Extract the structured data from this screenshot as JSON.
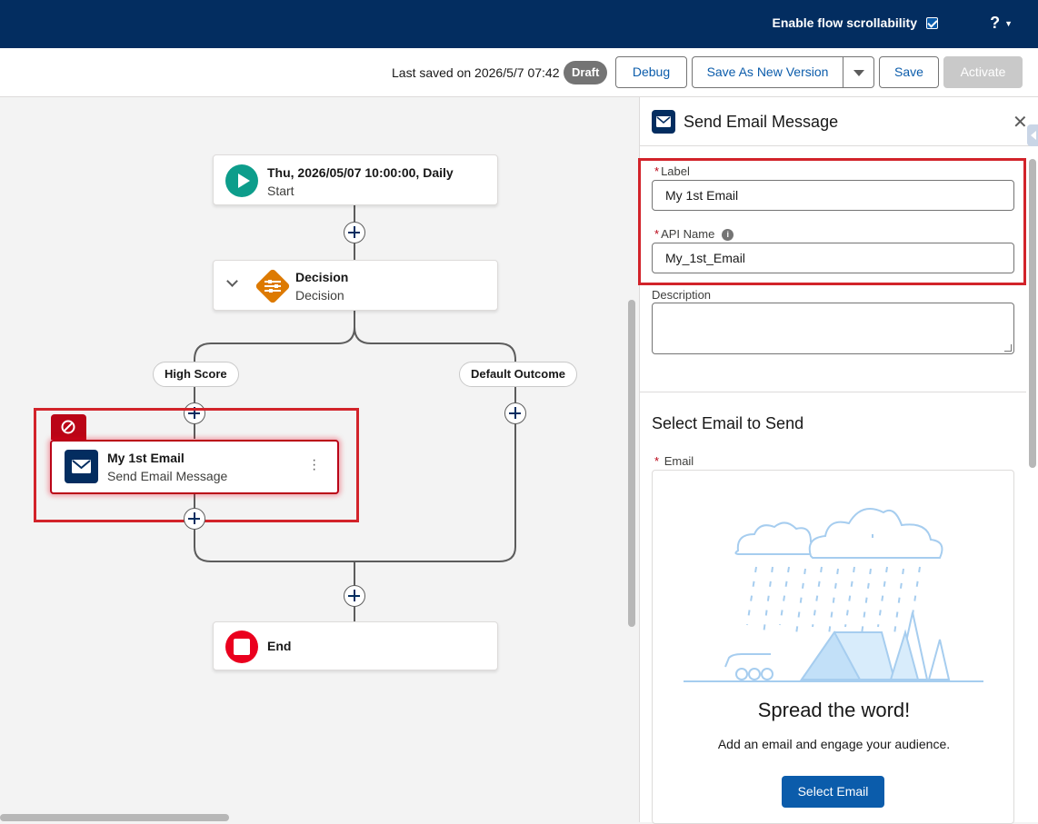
{
  "topbar": {
    "scroll_label": "Enable flow scrollability",
    "scroll_checked": true,
    "help_label": "?"
  },
  "toolbar": {
    "last_saved": "Last saved on 2026/5/7 07:42",
    "status_badge": "Draft",
    "debug_label": "Debug",
    "save_as_label": "Save As New Version",
    "save_label": "Save",
    "activate_label": "Activate"
  },
  "canvas": {
    "start": {
      "title": "Thu, 2026/05/07 10:00:00, Daily",
      "subtitle": "Start"
    },
    "decision": {
      "title": "Decision",
      "subtitle": "Decision"
    },
    "outcomes": {
      "high": "High Score",
      "default": "Default Outcome"
    },
    "email": {
      "title": "My 1st Email",
      "subtitle": "Send Email Message"
    },
    "end": {
      "title": "End"
    }
  },
  "panel": {
    "title": "Send Email Message",
    "label_field": {
      "label": "Label",
      "value": "My 1st Email"
    },
    "api_field": {
      "label": "API Name",
      "value": "My_1st_Email"
    },
    "description_field": {
      "label": "Description",
      "value": ""
    },
    "section_title": "Select Email to Send",
    "email_label": "Email",
    "empty_title": "Spread the word!",
    "empty_sub": "Add an email and engage your audience.",
    "select_button": "Select Email"
  },
  "colors": {
    "header": "#032d60",
    "brand": "#0b5cab",
    "start": "#0d9d8b",
    "decision": "#dd7a01",
    "end": "#ea001e",
    "error": "#d2232a"
  }
}
